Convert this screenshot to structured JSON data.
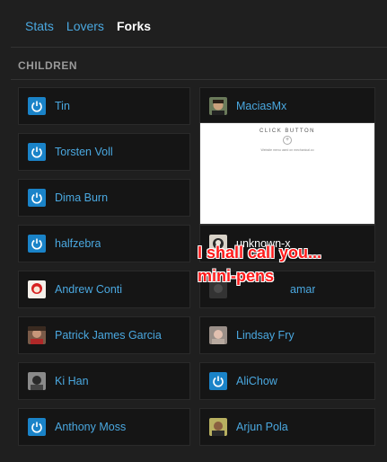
{
  "tabs": [
    {
      "label": "Stats"
    },
    {
      "label": "Lovers"
    },
    {
      "label": "Forks"
    }
  ],
  "section": {
    "title": "CHILDREN"
  },
  "left": [
    {
      "name": "Tin",
      "avatar": "default"
    },
    {
      "name": "Torsten Voll",
      "avatar": "default"
    },
    {
      "name": "Dima Burn",
      "avatar": "default"
    },
    {
      "name": "halfzebra",
      "avatar": "default"
    },
    {
      "name": "Andrew Conti",
      "avatar": "photo"
    },
    {
      "name": "Patrick James Garcia",
      "avatar": "photo"
    },
    {
      "name": "Ki Han",
      "avatar": "photo"
    },
    {
      "name": "Anthony Moss",
      "avatar": "default"
    }
  ],
  "right": [
    {
      "name": "MaciasMx",
      "avatar": "photo"
    },
    {
      "name": "unknown-x",
      "avatar": "photo"
    },
    {
      "name": "amar",
      "avatar": "photo"
    },
    {
      "name": "Lindsay Fry",
      "avatar": "photo"
    },
    {
      "name": "AliChow",
      "avatar": "default"
    },
    {
      "name": "Arjun Pola",
      "avatar": "photo"
    }
  ],
  "preview": {
    "title": "CLICK BUTTON",
    "subtitle": "Website menu used on mechanical.co"
  },
  "overlay": {
    "line1": "I shall call you...",
    "line2": "mini-pens"
  }
}
